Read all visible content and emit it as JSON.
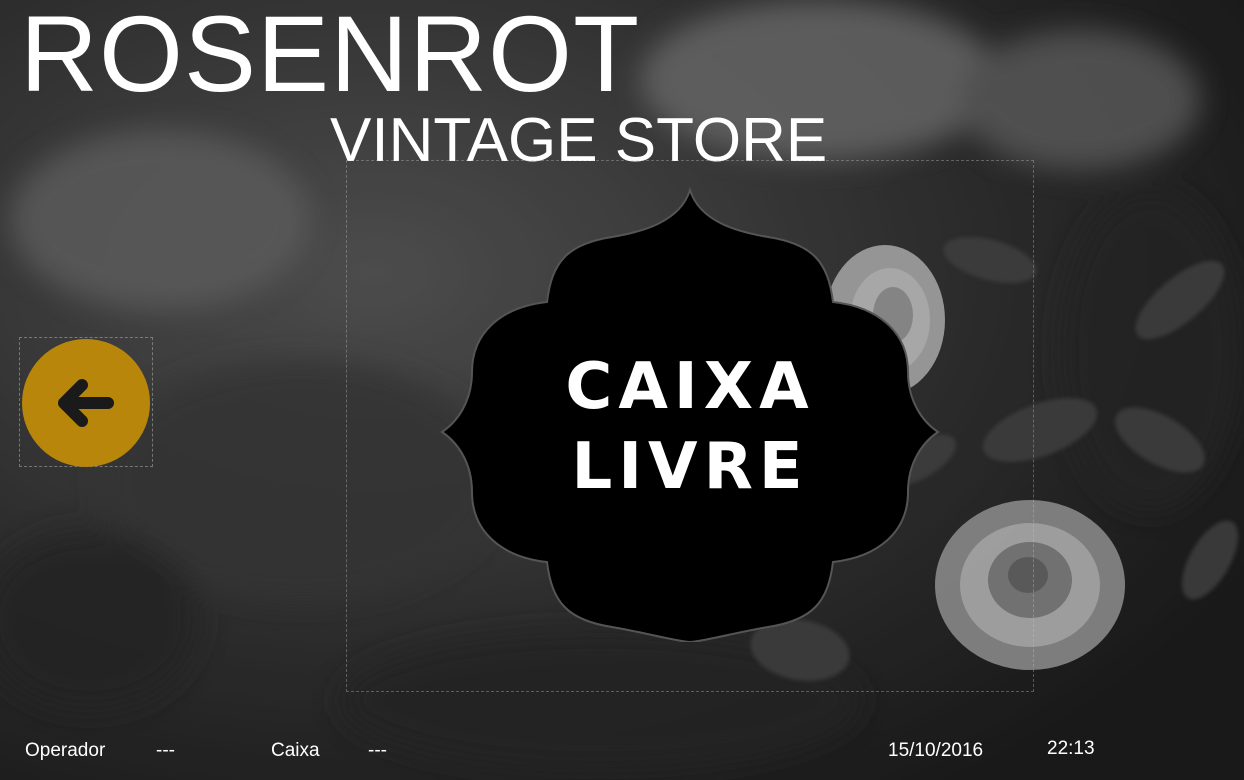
{
  "brand": {
    "title": "ROSENROT",
    "subtitle": "VINTAGE STORE"
  },
  "badge": {
    "line1": "CAIXA",
    "line2": "LIVRE"
  },
  "back_button": {
    "icon": "arrow-left-icon",
    "color": "#b8860b"
  },
  "status_bar": {
    "operator_label": "Operador",
    "operator_value": "---",
    "register_label": "Caixa",
    "register_value": "---",
    "date": "15/10/2016",
    "time": "22:13"
  }
}
